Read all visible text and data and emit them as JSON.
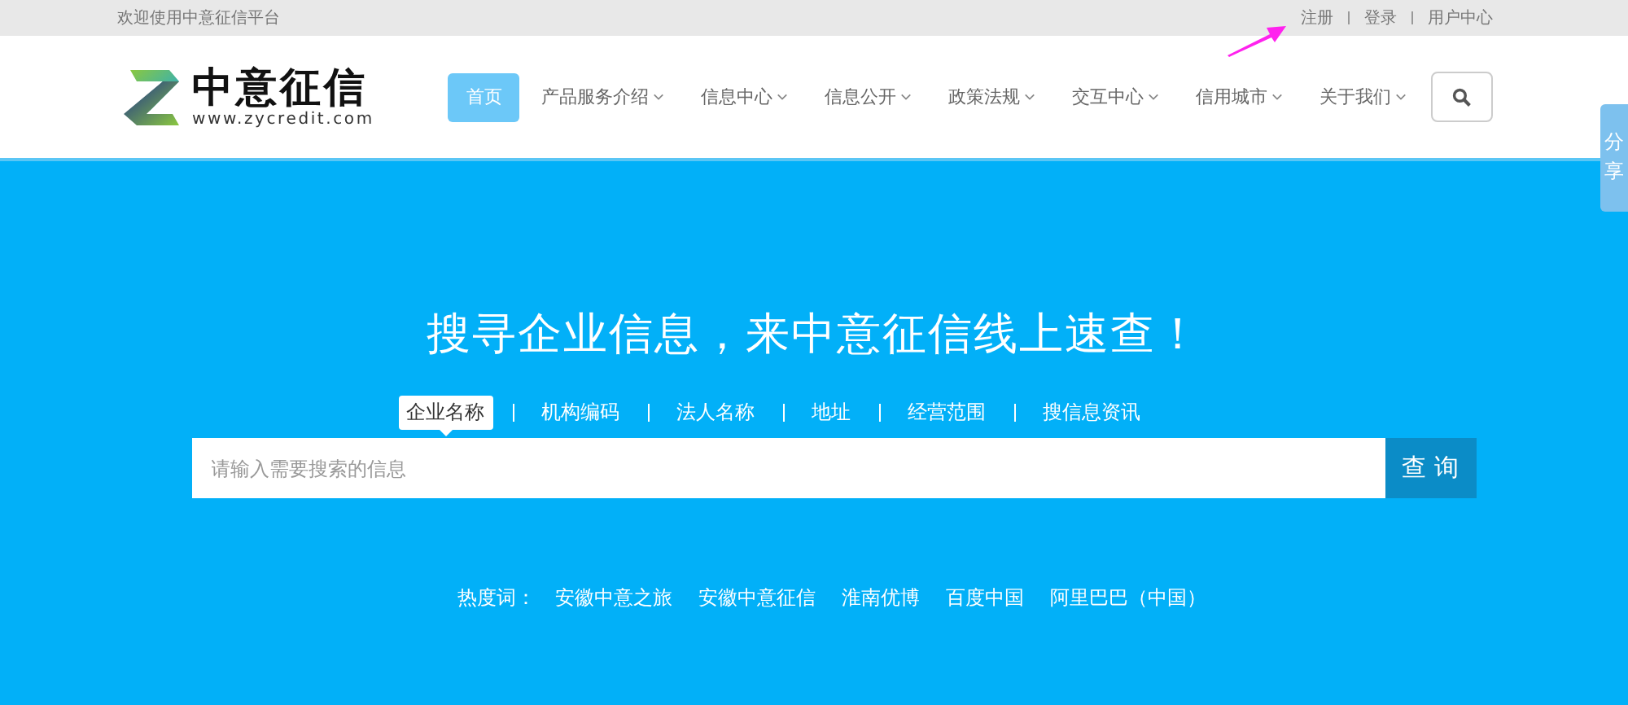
{
  "top_bar": {
    "welcome": "欢迎使用中意征信平台",
    "links": [
      "注册",
      "登录",
      "用户中心"
    ]
  },
  "logo": {
    "name": "中意征信",
    "url": "www.zycredit.com"
  },
  "nav": [
    {
      "label": "首页",
      "selected": true,
      "has_menu": false
    },
    {
      "label": "产品服务介绍",
      "selected": false,
      "has_menu": true
    },
    {
      "label": "信息中心",
      "selected": false,
      "has_menu": true
    },
    {
      "label": "信息公开",
      "selected": false,
      "has_menu": true
    },
    {
      "label": "政策法规",
      "selected": false,
      "has_menu": true
    },
    {
      "label": "交互中心",
      "selected": false,
      "has_menu": true
    },
    {
      "label": "信用城市",
      "selected": false,
      "has_menu": true
    },
    {
      "label": "关于我们",
      "selected": false,
      "has_menu": true
    }
  ],
  "share_tab": {
    "label": "分享"
  },
  "hero": {
    "title": "搜寻企业信息，来中意征信线上速查！"
  },
  "search_tabs": [
    {
      "label": "企业名称",
      "selected": true
    },
    {
      "label": "机构编码",
      "selected": false
    },
    {
      "label": "法人名称",
      "selected": false
    },
    {
      "label": "地址",
      "selected": false
    },
    {
      "label": "经营范围",
      "selected": false
    },
    {
      "label": "搜信息资讯",
      "selected": false
    }
  ],
  "search": {
    "placeholder": "请输入需要搜索的信息",
    "button": "查 询"
  },
  "hot_words": {
    "label": "热度词：",
    "items": [
      "安徽中意之旅",
      "安徽中意征信",
      "淮南优博",
      "百度中国",
      "阿里巴巴（中国）"
    ]
  }
}
